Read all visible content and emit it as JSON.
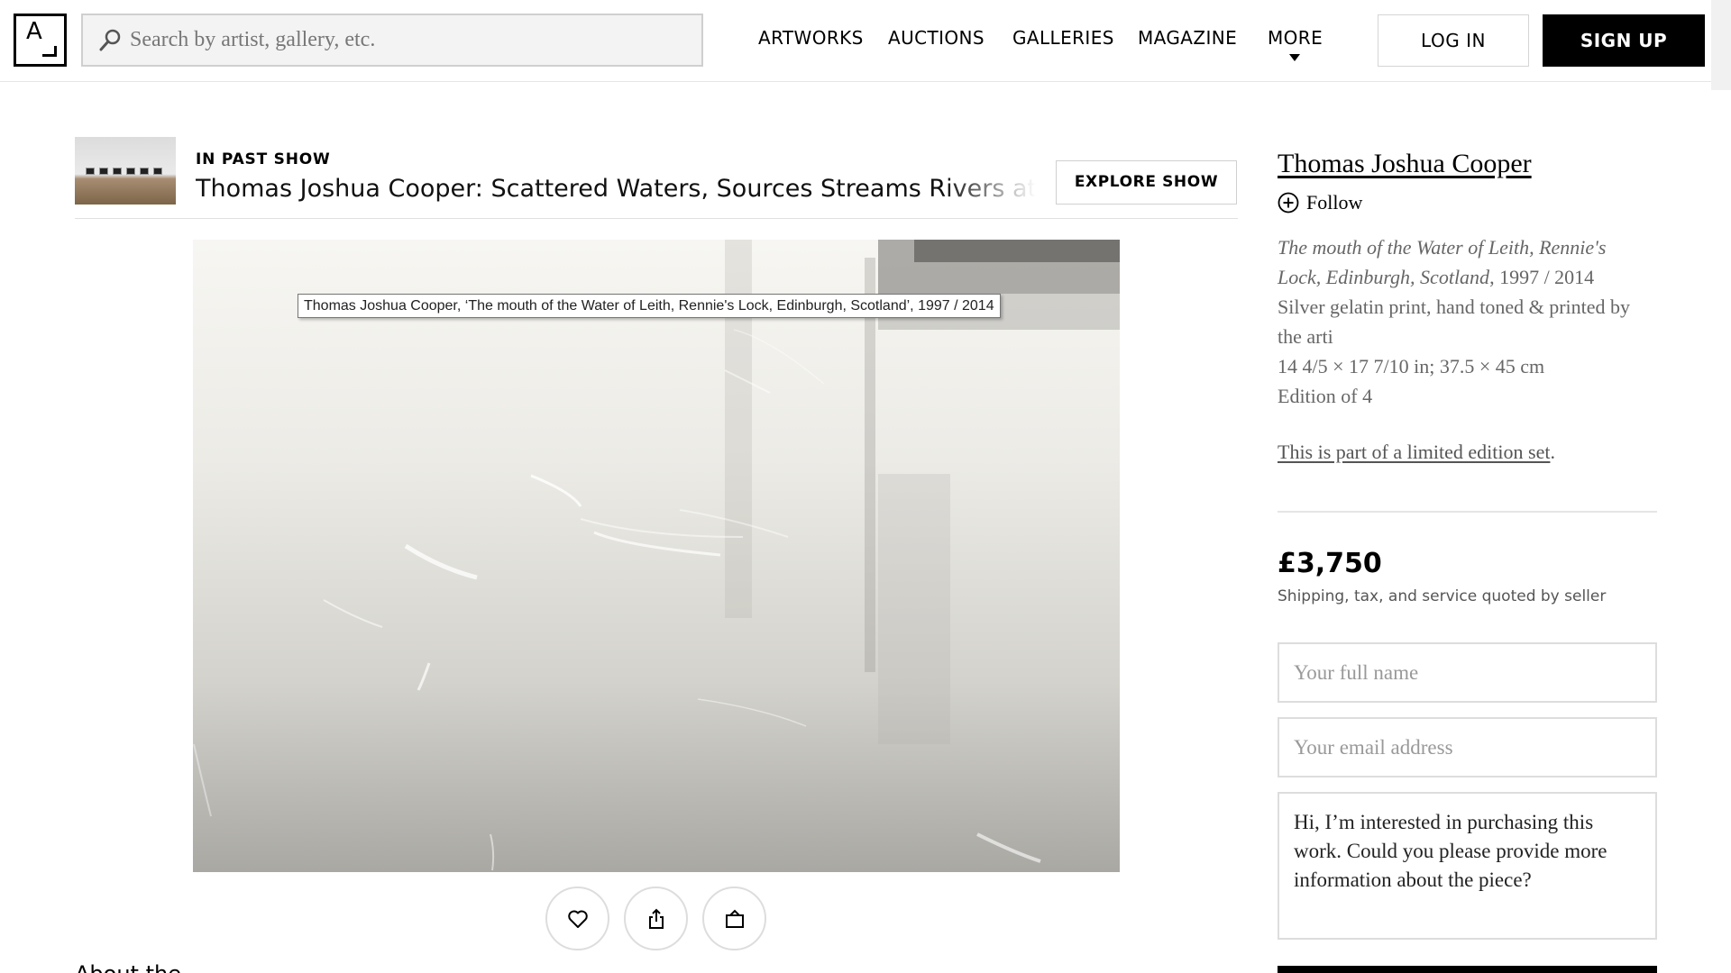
{
  "header": {
    "logo_letter": "A",
    "search_placeholder": "Search by artist, gallery, etc.",
    "nav": [
      "ARTWORKS",
      "AUCTIONS",
      "GALLERIES",
      "MAGAZINE",
      "MORE"
    ],
    "login_label": "LOG IN",
    "signup_label": "SIGN UP"
  },
  "show": {
    "kicker": "IN PAST SHOW",
    "title": "Thomas Joshua Cooper: Scattered Waters, Sources Streams Rivers at Ing",
    "explore_label": "EXPLORE SHOW"
  },
  "artwork": {
    "tooltip": "Thomas Joshua Cooper, ‘The mouth of the Water of Leith, Rennie's Lock, Edinburgh, Scotland’, 1997 / 2014"
  },
  "actions": {
    "icons": [
      "heart-icon",
      "share-icon",
      "view-in-room-icon"
    ]
  },
  "below_text": "About the work",
  "sidebar": {
    "artist": "Thomas Joshua Cooper",
    "follow_label": "Follow",
    "title_italic": "The mouth of the Water of Leith, Rennie's Lock, Edinburgh, Scotland",
    "date": ", 1997 / 2014",
    "medium": "Silver gelatin print, hand toned & printed by the arti",
    "dimensions": "14 4/5 × 17 7/10 in; 37.5 × 45 cm",
    "edition": "Edition of 4",
    "limited_link": "This is part of a limited edition set",
    "limited_suffix": ".",
    "price": "£3,750",
    "price_note": "Shipping, tax, and service quoted by seller",
    "name_placeholder": "Your full name",
    "email_placeholder": "Your email address",
    "message": "Hi, I’m interested in purchasing this work. Could you please provide more information about the piece?"
  },
  "colors": {
    "accent": "#000000",
    "border": "#dddddd",
    "muted_text": "#666666"
  }
}
